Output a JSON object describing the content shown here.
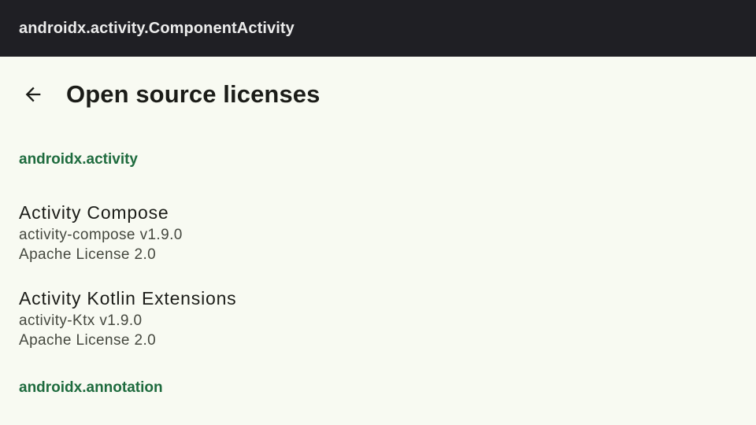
{
  "window": {
    "title": "androidx.activity.ComponentActivity"
  },
  "appbar": {
    "back_icon": "arrow-back-icon",
    "title": "Open source licenses"
  },
  "sections": [
    {
      "header": "androidx.activity",
      "items": [
        {
          "name": "Activity Compose",
          "artifact": "activity-compose v1.9.0",
          "license": "Apache License 2.0"
        },
        {
          "name": "Activity Kotlin Extensions",
          "artifact": "activity-Ktx v1.9.0",
          "license": "Apache License 2.0"
        }
      ]
    },
    {
      "header": "androidx.annotation",
      "items": []
    }
  ],
  "colors": {
    "titlebar_bg": "#1f1f24",
    "page_bg": "#f8faf2",
    "section_header": "#1e6b3e",
    "primary_text": "#1b1c18",
    "secondary_text": "#45483f"
  }
}
